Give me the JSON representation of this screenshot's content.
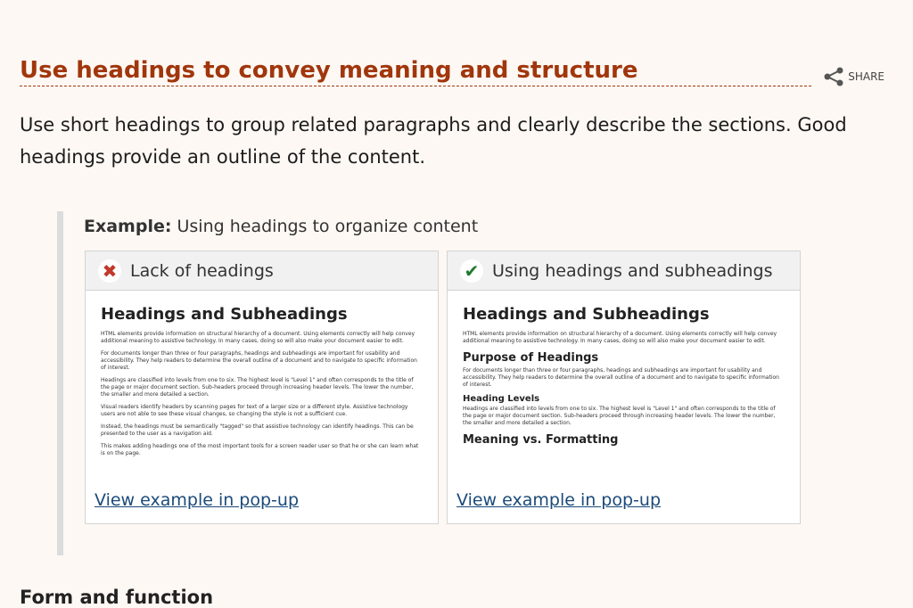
{
  "section": {
    "heading": "Use headings to convey meaning and structure",
    "share_label": "SHARE",
    "intro": "Use short headings to group related paragraphs and clearly describe the sections. Good headings provide an outline of the content."
  },
  "example": {
    "label_bold": "Example:",
    "label_text": "Using headings to organize content",
    "bad": {
      "title": "Lack of headings",
      "doc_title": "Headings and Subheadings",
      "paragraphs": [
        "HTML elements provide information on structural hierarchy of a document. Using elements correctly will help convey additional meaning to assistive technology. In many cases, doing so will also make your document easier to edit.",
        "For documents longer than three or four paragraphs, headings and subheadings are important for usability and accessibility. They help readers to determine the overall outline of a document and to navigate to specific information of interest.",
        "Headings are classified into levels from one to six. The highest level is \"Level 1\" and often corresponds to the title of the page or major document section. Sub-headers proceed through increasing header levels. The lower the number, the smaller and more detailed a section.",
        "Visual readers identify headers by scanning pages for text of a larger size or a different style. Assistive technology users are not able to see these visual changes, so changing the style is not a sufficient cue.",
        "Instead, the headings must be semantically \"tagged\" so that assistive technology can identify headings. This can be presented to the user as a navigation aid.",
        "This makes adding headings one of the most important tools for a screen reader user so that he or she can learn what is on the page."
      ],
      "link": "View example in pop-up"
    },
    "good": {
      "title": "Using headings and subheadings",
      "doc_title": "Headings and Subheadings",
      "intro_p": "HTML elements provide information on structural hierarchy of a document. Using elements correctly will help convey additional meaning to assistive technology. In many cases, doing so will also make your document easier to edit.",
      "h2_purpose": "Purpose of Headings",
      "purpose_p": "For documents longer than three or four paragraphs, headings and subheadings are important for usability and accessibility. They help readers to determine the overall outline of a document and to navigate to specific information of interest.",
      "h3_levels": "Heading Levels",
      "levels_p": "Headings are classified into levels from one to six. The highest level is \"Level 1\" and often corresponds to the title of the page or major document section. Sub-headers proceed through increasing header levels. The lower the number, the smaller and more detailed a section.",
      "h2_meaning": "Meaning vs. Formatting",
      "link": "View example in pop-up"
    }
  },
  "next_section_partial": "Form and function"
}
